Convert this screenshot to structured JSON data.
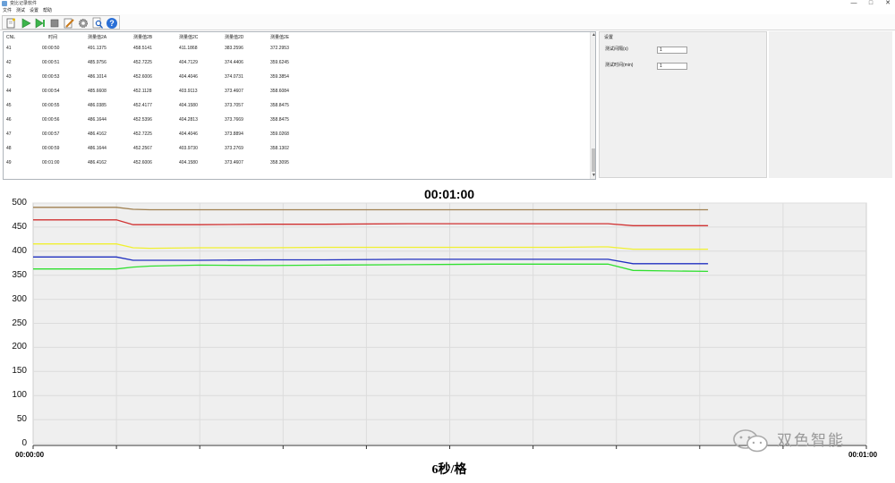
{
  "window": {
    "title": "变比记录软件",
    "minimize": "—",
    "maximize": "□",
    "close": "✕"
  },
  "menu": [
    "文件",
    "测试",
    "设置",
    "帮助"
  ],
  "toolbar": [
    {
      "icon": "new-file-icon"
    },
    {
      "icon": "play-icon"
    },
    {
      "icon": "step-play-icon"
    },
    {
      "icon": "stop-icon"
    },
    {
      "icon": "edit-icon"
    },
    {
      "icon": "gear-icon"
    },
    {
      "icon": "search-icon"
    },
    {
      "icon": "help-icon"
    }
  ],
  "table": {
    "columns": [
      "CNL",
      "时间",
      "测量值2A",
      "测量值2B",
      "测量值2C",
      "测量值2D",
      "测量值2E"
    ],
    "rows": [
      [
        "41",
        "00:00:50",
        "491.1375",
        "458.5141",
        "411.1868",
        "383.2596",
        "372.2953"
      ],
      [
        "42",
        "00:00:51",
        "485.9756",
        "452.7225",
        "404.7129",
        "374.4406",
        "359.6245"
      ],
      [
        "43",
        "00:00:53",
        "486.1014",
        "452.6006",
        "404.4046",
        "374.0731",
        "359.3854"
      ],
      [
        "44",
        "00:00:54",
        "485.6608",
        "452.1128",
        "403.9113",
        "373.4607",
        "358.6084"
      ],
      [
        "45",
        "00:00:55",
        "486.0385",
        "452.4177",
        "404.1580",
        "373.7057",
        "358.8475"
      ],
      [
        "46",
        "00:00:56",
        "486.1644",
        "452.5396",
        "404.2813",
        "373.7669",
        "358.8475"
      ],
      [
        "47",
        "00:00:57",
        "486.4162",
        "452.7225",
        "404.4046",
        "373.8894",
        "359.0268"
      ],
      [
        "48",
        "00:00:59",
        "486.1644",
        "452.2567",
        "403.9730",
        "373.2769",
        "358.1302"
      ],
      [
        "49",
        "00:01:00",
        "486.4162",
        "452.6006",
        "404.1580",
        "373.4607",
        "358.3095"
      ]
    ]
  },
  "settings": {
    "title": "设置",
    "fields": [
      {
        "label": "测试间隔(s)",
        "value": "1"
      },
      {
        "label": "测试时间(min)",
        "value": "1"
      }
    ]
  },
  "chart": {
    "title": "00:01:00",
    "x_start_label": "00:00:00",
    "x_end_label": "00:01:00",
    "xlabel": "6秒/格",
    "watermark": "双色智能"
  },
  "chart_data": {
    "type": "line",
    "title": "00:01:00",
    "xlabel": "6秒/格",
    "ylabel": "",
    "ylim": [
      0,
      500
    ],
    "yticks": [
      0,
      50,
      100,
      150,
      200,
      250,
      300,
      350,
      400,
      450,
      500
    ],
    "xlim": [
      0,
      100
    ],
    "x_tick_labels": [
      "00:00:00",
      "00:01:00"
    ],
    "grid": true,
    "x": [
      0,
      5,
      8,
      10,
      12,
      14,
      20,
      28,
      35,
      45,
      55,
      63,
      68,
      69,
      72,
      76,
      81
    ],
    "series": [
      {
        "color": "#a08050",
        "values": [
          491,
          491,
          491,
          491,
          487,
          486,
          486,
          486,
          486,
          486,
          486,
          486,
          486,
          486,
          486,
          486,
          486
        ]
      },
      {
        "color": "#d03030",
        "values": [
          465,
          465,
          465,
          465,
          455,
          455,
          455,
          456,
          456,
          457,
          457,
          457,
          457,
          457,
          453,
          453,
          453
        ]
      },
      {
        "color": "#f0f030",
        "values": [
          415,
          415,
          415,
          415,
          407,
          406,
          407,
          407,
          408,
          408,
          408,
          408,
          409,
          409,
          404,
          404,
          404
        ]
      },
      {
        "color": "#2030c0",
        "values": [
          388,
          388,
          388,
          388,
          381,
          381,
          381,
          382,
          382,
          383,
          383,
          383,
          383,
          383,
          374,
          374,
          374
        ]
      },
      {
        "color": "#30e030",
        "values": [
          363,
          363,
          363,
          363,
          367,
          369,
          371,
          370,
          371,
          372,
          373,
          373,
          373,
          373,
          360,
          359,
          358
        ]
      }
    ]
  }
}
